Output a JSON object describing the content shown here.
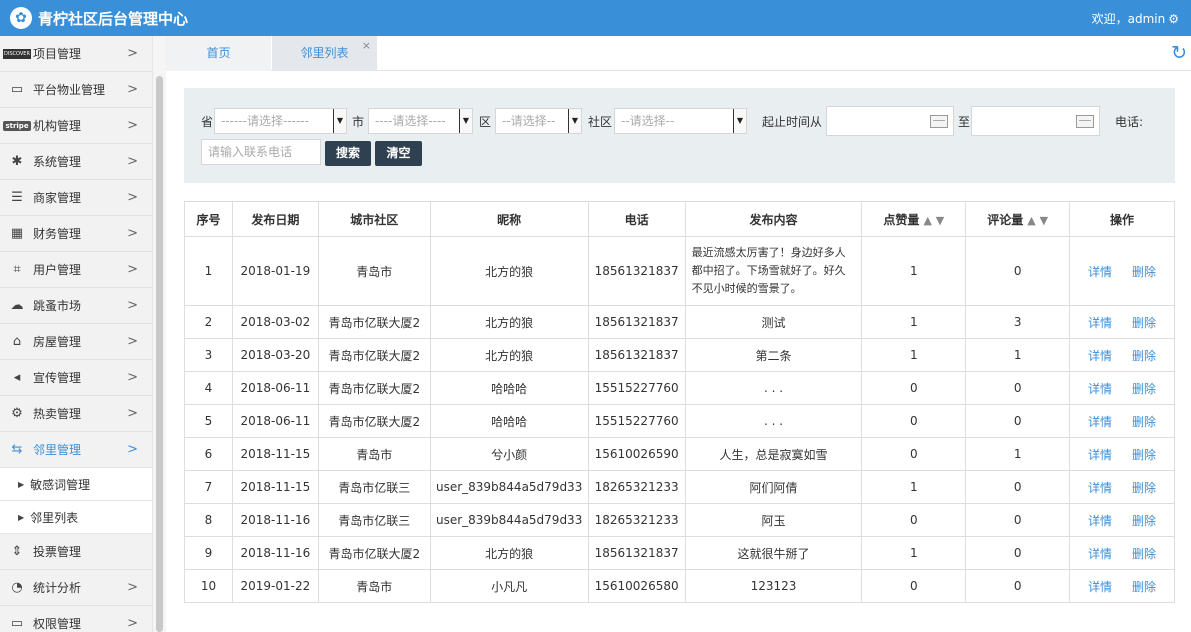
{
  "header": {
    "logo_glyph": "✿",
    "title": "青柠社区后台管理中心",
    "welcome": "欢迎，admin"
  },
  "sidebar": {
    "items": [
      {
        "label": "项目管理",
        "icon": "discover-card-icon"
      },
      {
        "label": "平台物业管理",
        "icon": "monitor-icon"
      },
      {
        "label": "机构管理",
        "icon": "stripe-icon"
      },
      {
        "label": "系统管理",
        "icon": "yelp-icon"
      },
      {
        "label": "商家管理",
        "icon": "list-icon"
      },
      {
        "label": "财务管理",
        "icon": "calculator-icon"
      },
      {
        "label": "用户管理",
        "icon": "crop-icon"
      },
      {
        "label": "跳蚤市场",
        "icon": "cloud-icon"
      },
      {
        "label": "房屋管理",
        "icon": "bank-icon"
      },
      {
        "label": "宣传管理",
        "icon": "volume-icon"
      },
      {
        "label": "热卖管理",
        "icon": "gear-icon"
      },
      {
        "label": "邻里管理",
        "icon": "retweet-icon"
      },
      {
        "label": "投票管理",
        "icon": "sort-icon"
      },
      {
        "label": "统计分析",
        "icon": "pie-chart-icon"
      },
      {
        "label": "权限管理",
        "icon": "desktop-icon"
      }
    ],
    "sub_items": [
      "敏感词管理",
      "邻里列表"
    ],
    "accent": "#3a8fd9"
  },
  "tabs": [
    {
      "label": "首页"
    },
    {
      "label": "邻里列表",
      "close": "×"
    }
  ],
  "filter": {
    "province_label": "省",
    "province_value": "------请选择------",
    "city_label": "市",
    "city_value": "----请选择----",
    "district_label": "区",
    "district_value": "--请选择--",
    "community_label": "社区",
    "community_value": "--请选择--",
    "time_from_label": "起止时间从",
    "time_to_label": "至",
    "phone_label": "电话:",
    "phone_placeholder": "请输入联系电话",
    "search_button": "搜索",
    "clear_button": "清空"
  },
  "table": {
    "headers": [
      "序号",
      "发布日期",
      "城市社区",
      "昵称",
      "电话",
      "发布内容",
      "点赞量",
      "评论量",
      "操作"
    ],
    "sort_glyph": "▲ ▼",
    "action_detail": "详情",
    "action_delete": "删除",
    "rows": [
      [
        "1",
        "2018-01-19",
        "青岛市",
        "北方的狼",
        "18561321837",
        "最近流感太厉害了！身边好多人都中招了。下场雪就好了。好久不见小时候的雪景了。",
        "1",
        "0"
      ],
      [
        "2",
        "2018-03-02",
        "青岛市亿联大厦2",
        "北方的狼",
        "18561321837",
        "测试",
        "1",
        "3"
      ],
      [
        "3",
        "2018-03-20",
        "青岛市亿联大厦2",
        "北方的狼",
        "18561321837",
        "第二条",
        "1",
        "1"
      ],
      [
        "4",
        "2018-06-11",
        "青岛市亿联大厦2",
        "哈哈哈",
        "15515227760",
        ". . .",
        "0",
        "0"
      ],
      [
        "5",
        "2018-06-11",
        "青岛市亿联大厦2",
        "哈哈哈",
        "15515227760",
        ". . .",
        "0",
        "0"
      ],
      [
        "6",
        "2018-11-15",
        "青岛市",
        "兮小颜",
        "15610026590",
        "人生，总是寂寞如雪",
        "0",
        "1"
      ],
      [
        "7",
        "2018-11-15",
        "青岛市亿联三",
        "user_839b844a5d79d33",
        "18265321233",
        "阿们阿倩",
        "1",
        "0"
      ],
      [
        "8",
        "2018-11-16",
        "青岛市亿联三",
        "user_839b844a5d79d33",
        "18265321233",
        "阿玉",
        "0",
        "0"
      ],
      [
        "9",
        "2018-11-16",
        "青岛市亿联大厦2",
        "北方的狼",
        "18561321837",
        "这就很牛掰了",
        "1",
        "0"
      ],
      [
        "10",
        "2019-01-22",
        "青岛市",
        "小凡凡",
        "15610026580",
        "123123",
        "0",
        "0"
      ]
    ]
  }
}
